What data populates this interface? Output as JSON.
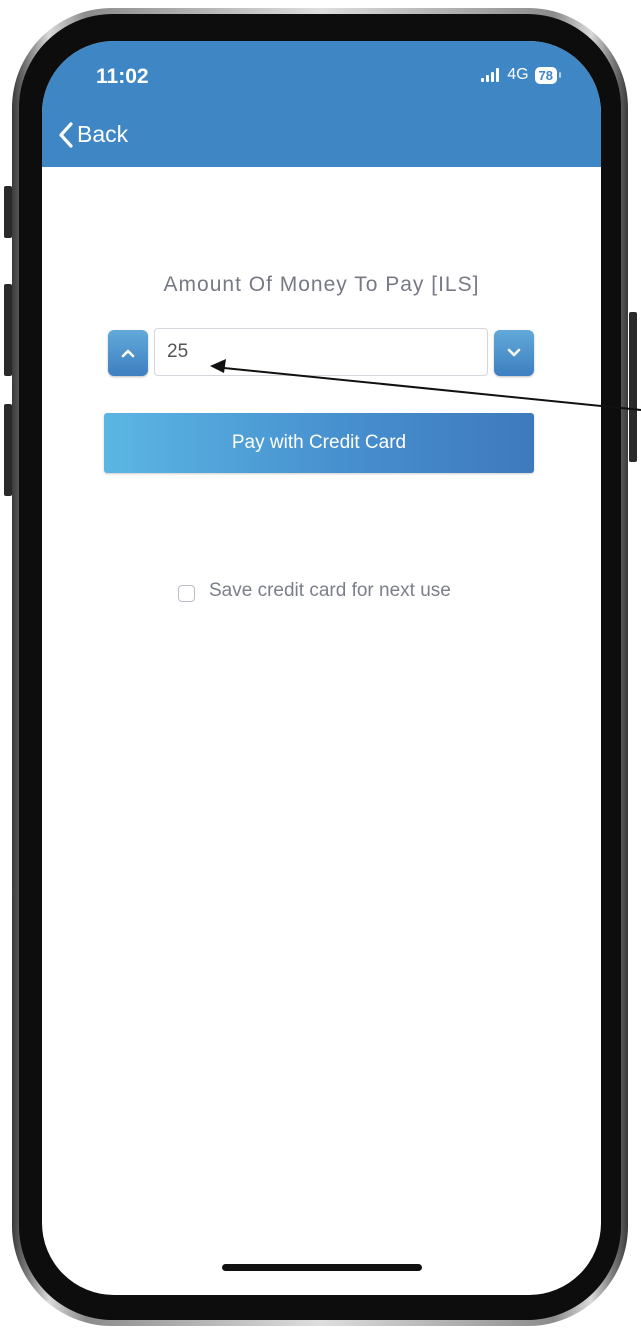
{
  "status_bar": {
    "time": "11:02",
    "network": "4G",
    "battery": "78"
  },
  "nav": {
    "back_label": "Back"
  },
  "payment": {
    "title": "Amount Of Money To Pay [ILS]",
    "amount_value": "25",
    "pay_button_label": "Pay with Credit Card",
    "save_card_label": "Save credit card for next use",
    "save_card_checked": false
  },
  "colors": {
    "nav_background": "#3f86c5",
    "button_gradient_start": "#5bb6e3",
    "button_gradient_end": "#3e79bd",
    "text_muted": "#777a86"
  },
  "icons": {
    "back": "chevron-left-icon",
    "increment": "chevron-up-icon",
    "decrement": "chevron-down-icon",
    "signal": "signal-icon",
    "battery": "battery-icon"
  }
}
